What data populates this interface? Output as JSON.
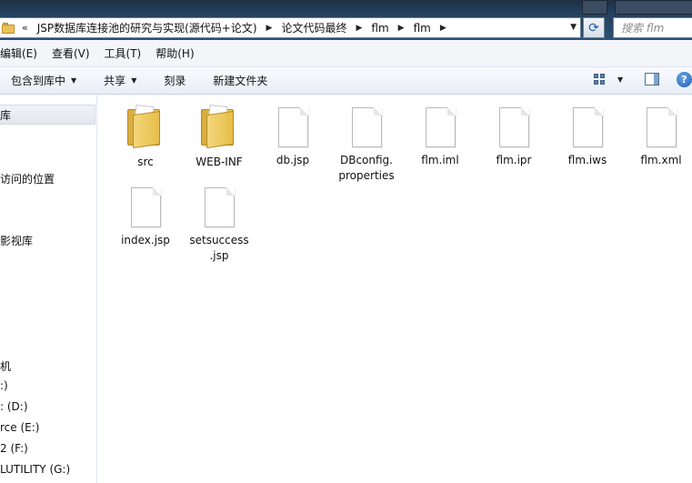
{
  "address_bar": {
    "chevrons": "«",
    "breadcrumbs": [
      "JSP数据库连接池的研究与实现(源代码+论文)",
      "论文代码最终",
      "flm",
      "flm"
    ],
    "search_placeholder": "搜索 flm"
  },
  "menu": {
    "items": [
      "编辑(E)",
      "查看(V)",
      "工具(T)",
      "帮助(H)"
    ]
  },
  "toolbar": {
    "include_in_library": "包含到库中",
    "share": "共享",
    "burn": "刻录",
    "new_folder": "新建文件夹",
    "help": "?"
  },
  "nav": {
    "items": [
      "库",
      "访问的位置",
      "影视库",
      "机",
      ":)",
      ": (D:)",
      "rce (E:)",
      "2 (F:)",
      "LUTILITY (G:)"
    ]
  },
  "files": [
    {
      "name": "src",
      "type": "folder"
    },
    {
      "name": "WEB-INF",
      "type": "folder"
    },
    {
      "name": "db.jsp",
      "type": "file"
    },
    {
      "name": "DBconfig.\nproperties",
      "type": "file",
      "lines": [
        "DBconfig.",
        "properties"
      ]
    },
    {
      "name": "flm.iml",
      "type": "file"
    },
    {
      "name": "flm.ipr",
      "type": "file"
    },
    {
      "name": "flm.iws",
      "type": "file"
    },
    {
      "name": "flm.xml",
      "type": "file"
    },
    {
      "name": "index.jsp",
      "type": "file"
    },
    {
      "name": "setsuccess\n.jsp",
      "type": "file",
      "lines": [
        "setsuccess",
        ".jsp"
      ]
    }
  ],
  "colors": {
    "address_bar_bg": "#2b5176",
    "toolbar_bg": "#e8eef7",
    "folder": "#e9c25a"
  }
}
